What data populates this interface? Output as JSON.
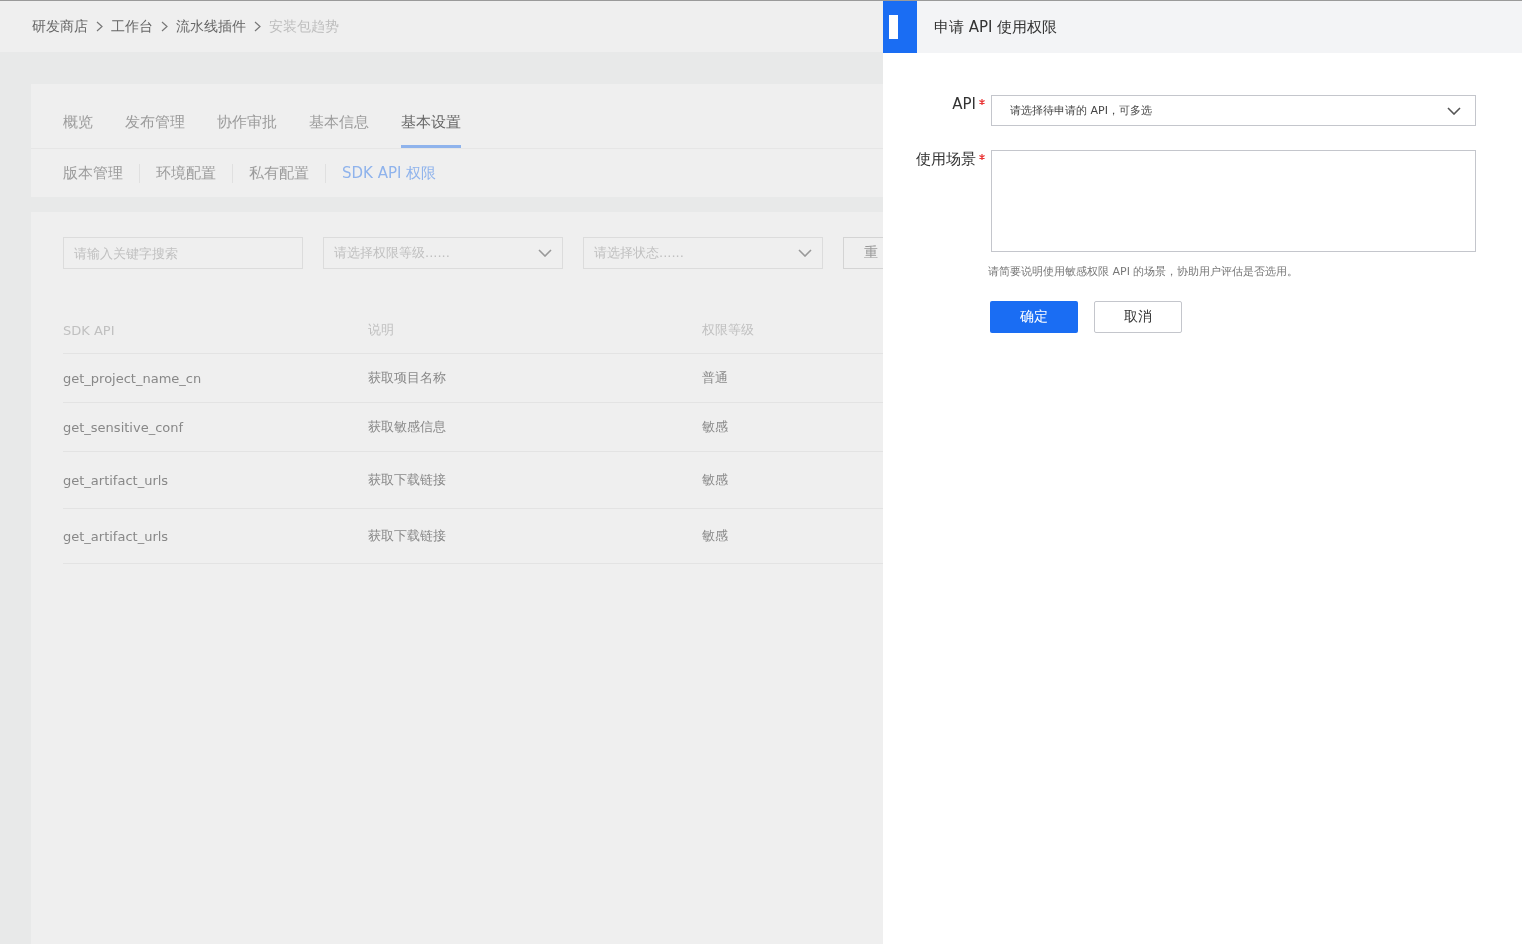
{
  "breadcrumb": [
    {
      "label": "研发商店",
      "current": false
    },
    {
      "label": "工作台",
      "current": false
    },
    {
      "label": "流水线插件",
      "current": false
    },
    {
      "label": "安装包趋势",
      "current": true
    }
  ],
  "tabs": [
    {
      "label": "概览",
      "selected": false
    },
    {
      "label": "发布管理",
      "selected": false
    },
    {
      "label": "协作审批",
      "selected": false
    },
    {
      "label": "基本信息",
      "selected": false
    },
    {
      "label": "基本设置",
      "selected": true
    }
  ],
  "subtabs": [
    {
      "label": "版本管理",
      "selected": false
    },
    {
      "label": "环境配置",
      "selected": false
    },
    {
      "label": "私有配置",
      "selected": false
    },
    {
      "label": "SDK API 权限",
      "selected": true
    }
  ],
  "filters": {
    "search_placeholder": "请输入关键字搜索",
    "level_placeholder": "请选择权限等级......",
    "status_placeholder": "请选择状态......",
    "reset_button": "重"
  },
  "table": {
    "columns": [
      "SDK API",
      "说明",
      "权限等级"
    ],
    "rows": [
      [
        "get_project_name_cn",
        "获取项目名称",
        "普通"
      ],
      [
        "get_sensitive_conf",
        "获取敏感信息",
        "敏感"
      ],
      [
        "get_artifact_urls",
        "获取下载链接",
        "敏感"
      ],
      [
        "get_artifact_urls",
        "获取下载链接",
        "敏感"
      ]
    ]
  },
  "drawer": {
    "title": "申请 API 使用权限",
    "api_label": "API",
    "api_required": true,
    "api_placeholder": "请选择待申请的 API，可多选",
    "scene_label": "使用场景",
    "scene_required": true,
    "hint": "请简要说明使用敏感权限 API 的场景，协助用户评估是否选用。",
    "confirm_button": "确定",
    "cancel_button": "取消"
  }
}
